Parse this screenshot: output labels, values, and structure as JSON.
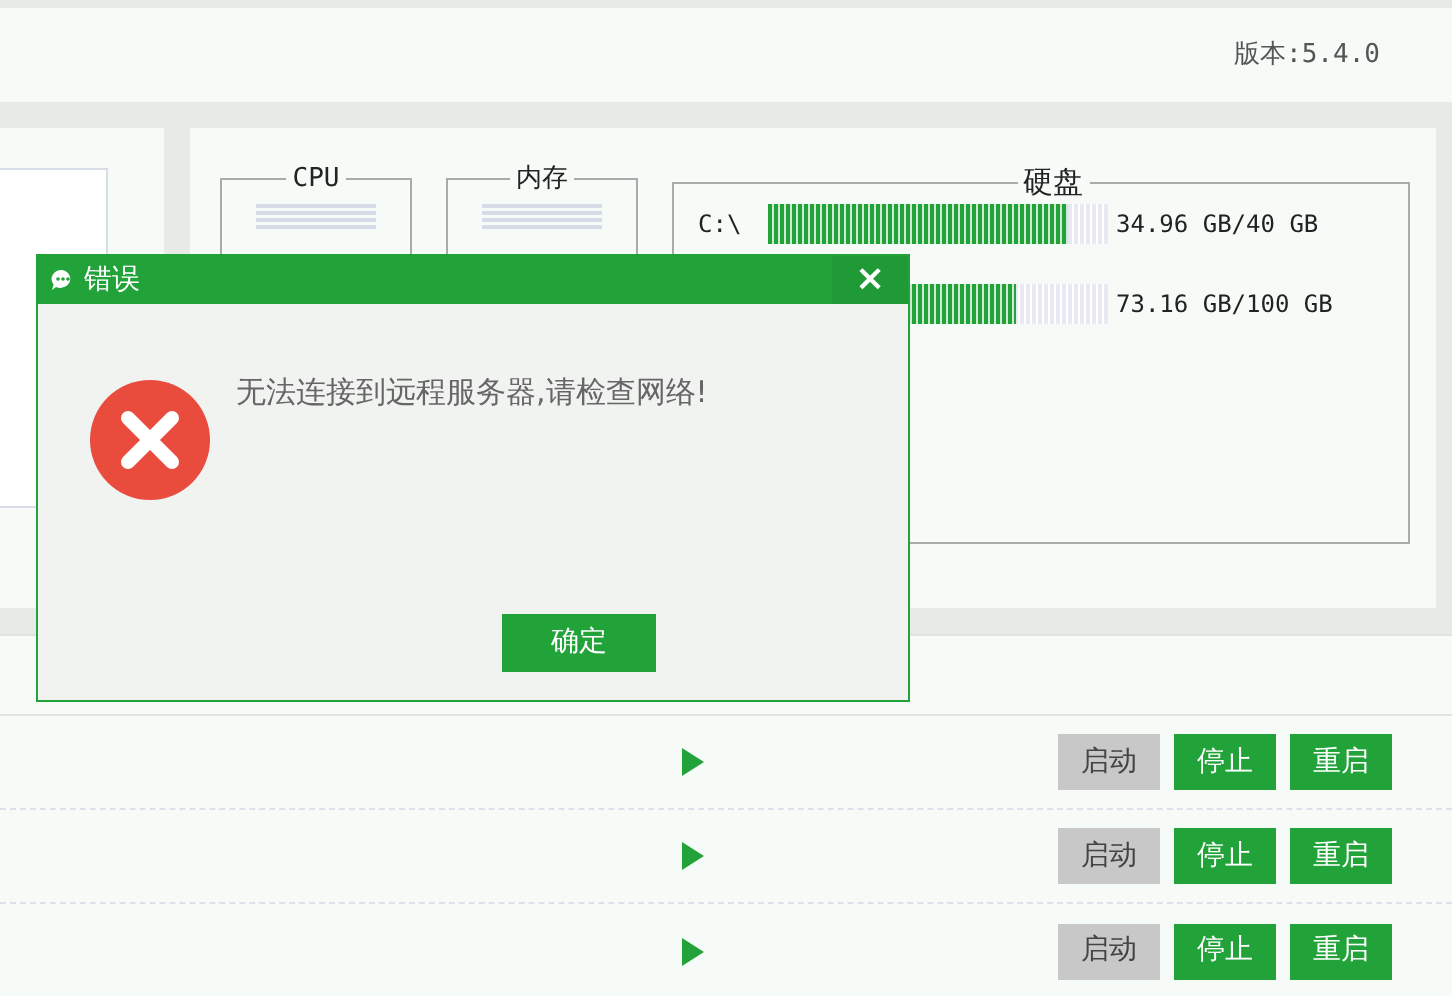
{
  "header": {
    "version": "版本:5.4.0"
  },
  "monitors": [
    {
      "title": "CPU"
    },
    {
      "title": "内存"
    }
  ],
  "disk": {
    "title": "硬盘",
    "drives": [
      {
        "label": "C:\\",
        "level": 0.88,
        "reading": "34.96 GB/40 GB"
      },
      {
        "level": 0.73,
        "reading": "73.16 GB/100 GB"
      }
    ]
  },
  "services": [
    {
      "buttons": [
        {
          "label": "启动",
          "disabled": true
        },
        {
          "label": "停止",
          "disabled": false
        },
        {
          "label": "重启",
          "disabled": false
        }
      ]
    },
    {
      "buttons": [
        {
          "label": "启动",
          "disabled": true
        },
        {
          "label": "停止",
          "disabled": false
        },
        {
          "label": "重启",
          "disabled": false
        }
      ]
    },
    {
      "buttons": [
        {
          "label": "启动",
          "disabled": true
        },
        {
          "label": "停止",
          "disabled": false
        },
        {
          "label": "重启",
          "disabled": false
        }
      ]
    }
  ],
  "dialog": {
    "title": "错误",
    "close": "×",
    "message": "无法连接到远程服务器,请检查网络!",
    "ok": "确定"
  }
}
